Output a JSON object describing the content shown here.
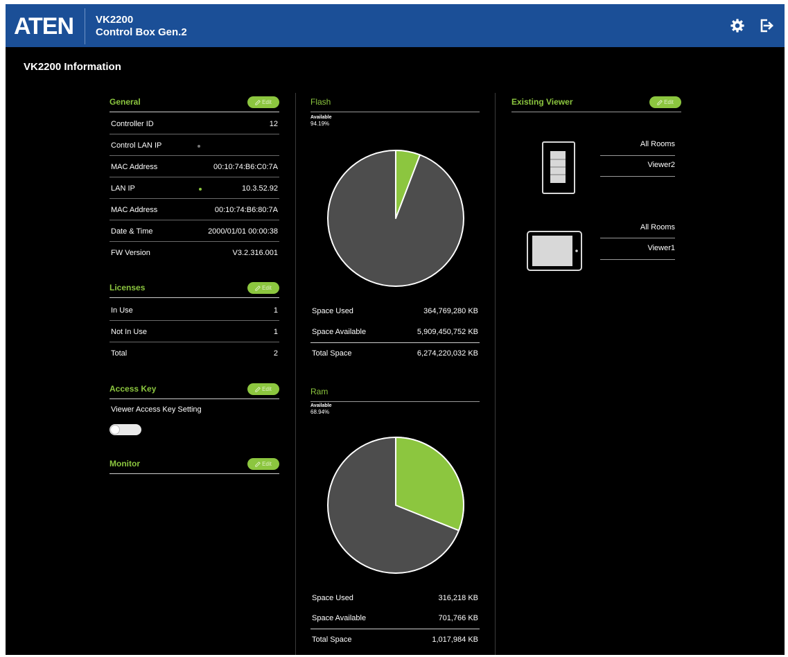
{
  "header": {
    "logo": "ATEN",
    "model": "VK2200",
    "product_name": "Control Box Gen.2",
    "settings_icon": "gear-icon",
    "logout_icon": "logout-icon"
  },
  "page_title": "VK2200 Information",
  "edit_label": "Edit",
  "general": {
    "title": "General",
    "rows": [
      {
        "label": "Controller ID",
        "value": "12"
      },
      {
        "label": "Control LAN IP",
        "value": ""
      },
      {
        "label": "MAC Address",
        "value": "00:10:74:B6:C0:7A"
      },
      {
        "label": "LAN IP",
        "value": "10.3.52.92"
      },
      {
        "label": "MAC Address",
        "value": "00:10:74:B6:80:7A"
      },
      {
        "label": "Date & Time",
        "value": "2000/01/01 00:00:38"
      },
      {
        "label": "FW Version",
        "value": "V3.2.316.001"
      }
    ]
  },
  "licenses": {
    "title": "Licenses",
    "rows": [
      {
        "label": "In Use",
        "value": "1"
      },
      {
        "label": "Not In Use",
        "value": "1"
      },
      {
        "label": "Total",
        "value": "2"
      }
    ]
  },
  "access_key": {
    "title": "Access Key",
    "setting_label": "Viewer Access Key Setting",
    "enabled": false
  },
  "monitor": {
    "title": "Monitor"
  },
  "flash": {
    "title": "Flash",
    "available_label": "Available",
    "available_pct": "94.19%",
    "used_fraction": 0.0581,
    "rows": [
      {
        "label": "Space Used",
        "value": "364,769,280 KB"
      },
      {
        "label": "Space Available",
        "value": "5,909,450,752 KB"
      },
      {
        "label": "Total Space",
        "value": "6,274,220,032 KB"
      }
    ]
  },
  "ram": {
    "title": "Ram",
    "available_label": "Available",
    "available_pct": "68.94%",
    "used_fraction": 0.3106,
    "rows": [
      {
        "label": "Space Used",
        "value": "316,218 KB"
      },
      {
        "label": "Space Available",
        "value": "701,766 KB"
      },
      {
        "label": "Total Space",
        "value": "1,017,984 KB"
      }
    ]
  },
  "existing_viewer": {
    "title": "Existing Viewer",
    "viewers": [
      {
        "room": "All Rooms",
        "name": "Viewer2",
        "device": "wall-panel-icon"
      },
      {
        "room": "All Rooms",
        "name": "Viewer1",
        "device": "tablet-icon"
      }
    ]
  },
  "colors": {
    "header_bg": "#1b4f97",
    "accent": "#8cc63f",
    "pie_base": "#4d4d4d",
    "background": "#000000"
  }
}
